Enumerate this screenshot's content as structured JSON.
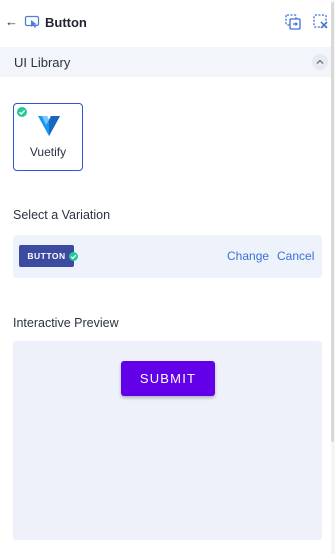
{
  "header": {
    "back_icon": "arrow-left-icon",
    "component_icon": "component-icon",
    "title": "Button",
    "actions": [
      "swap-icon",
      "close-selection-icon"
    ]
  },
  "ui_library": {
    "title": "UI Library",
    "collapse_icon": "chevron-up-icon",
    "selected": "Vuetify",
    "logo_icon": "vuetify-logo"
  },
  "variation": {
    "label": "Select a Variation",
    "chip_label": "BUTTON",
    "change_label": "Change",
    "cancel_label": "Cancel"
  },
  "preview": {
    "label": "Interactive Preview",
    "button_label": "SUBMIT"
  },
  "colors": {
    "accent": "#2f55d4",
    "link": "#3d6fd8",
    "chip": "#3c4aa0",
    "check": "#20c997",
    "submit": "#6200ea",
    "panel_bg": "#eef1fa"
  }
}
